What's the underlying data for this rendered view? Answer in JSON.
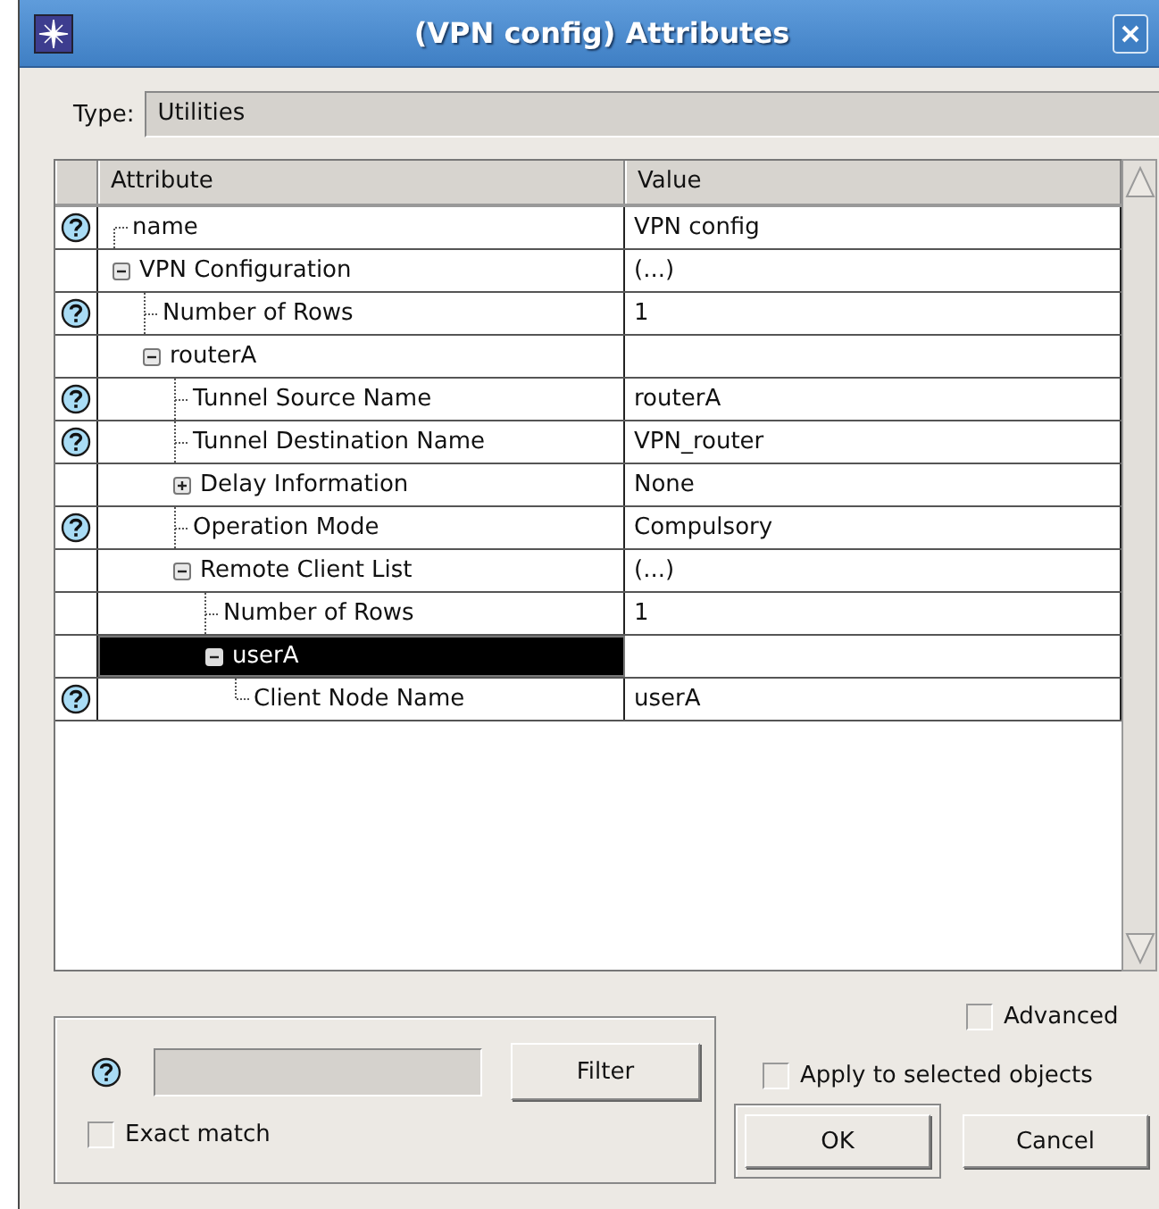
{
  "window": {
    "title": "(VPN config) Attributes"
  },
  "type_field": {
    "label": "Type:",
    "value": "Utilities"
  },
  "table": {
    "columns": [
      "Attribute",
      "Value"
    ],
    "rows": [
      {
        "name": "name",
        "value": "VPN config",
        "help": true,
        "selected": false
      },
      {
        "name": "VPN Configuration",
        "value": "(...)",
        "help": false,
        "selected": false,
        "expanded": true,
        "children": [
          {
            "name": "Number of Rows",
            "value": "1",
            "help": true,
            "selected": false
          },
          {
            "name": "routerA",
            "help": false,
            "selected": false,
            "expanded": true,
            "children": [
              {
                "name": "Tunnel Source Name",
                "value": "routerA",
                "help": true,
                "selected": false
              },
              {
                "name": "Tunnel Destination Name",
                "value": "VPN_router",
                "help": true,
                "selected": false
              },
              {
                "name": "Delay Information",
                "value": "None",
                "help": false,
                "selected": false,
                "expanded": false
              },
              {
                "name": "Operation Mode",
                "value": "Compulsory",
                "help": true,
                "selected": false
              },
              {
                "name": "Remote Client List",
                "value": "(...)",
                "help": false,
                "selected": false,
                "expanded": true,
                "children": [
                  {
                    "name": "Number of Rows",
                    "value": "1",
                    "help": false,
                    "selected": false
                  },
                  {
                    "name": "userA",
                    "help": false,
                    "selected": true,
                    "expanded": true,
                    "children": [
                      {
                        "name": "Client Node Name",
                        "value": "userA",
                        "help": true,
                        "selected": false
                      }
                    ]
                  }
                ]
              }
            ]
          }
        ]
      }
    ]
  },
  "filter": {
    "button": {
      "label": "Filter"
    },
    "exact_match": {
      "label": "Exact match",
      "checked": false
    }
  },
  "advanced": {
    "label": "Advanced",
    "checked": false
  },
  "apply_selected": {
    "label": "Apply to selected objects",
    "checked": false
  },
  "buttons": [
    {
      "label": "OK",
      "default": true
    },
    {
      "label": "Cancel",
      "default": false
    }
  ]
}
